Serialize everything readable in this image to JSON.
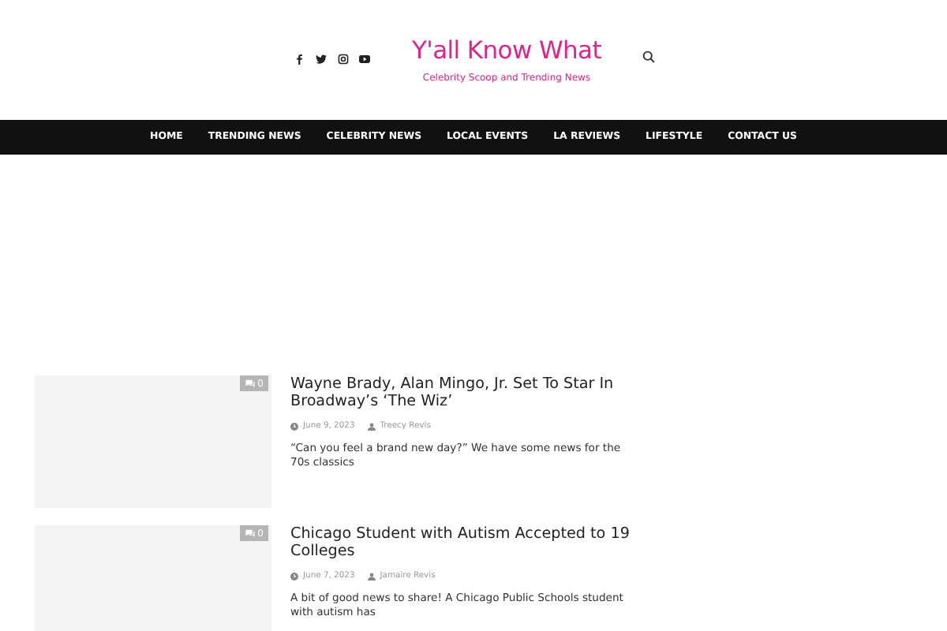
{
  "header": {
    "social": [
      {
        "kind": "facebook"
      },
      {
        "kind": "twitter"
      },
      {
        "kind": "instagram"
      },
      {
        "kind": "youtube"
      }
    ],
    "site_title": "Y'all Know What",
    "tagline": "Celebrity Scoop and Trending News"
  },
  "nav": [
    "HOME",
    "TRENDING NEWS",
    "CELEBRITY NEWS",
    "LOCAL EVENTS",
    "LA REVIEWS",
    "LIFESTYLE",
    "CONTACT US"
  ],
  "posts": [
    {
      "comments": "0",
      "title": "Wayne Brady, Alan Mingo, Jr. Set To Star In Broadway’s ‘The Wiz’",
      "date": "June 9, 2023",
      "author": "Treecy Revis",
      "excerpt": "“Can you feel a brand new day?” We have some news for the 70s classics"
    },
    {
      "comments": "0",
      "title": "Chicago Student with Autism Accepted to 19 Colleges",
      "date": "June 7, 2023",
      "author": "Jamaire Revis",
      "excerpt": "A bit of good news to share! A Chicago Public Schools student with autism has"
    }
  ]
}
